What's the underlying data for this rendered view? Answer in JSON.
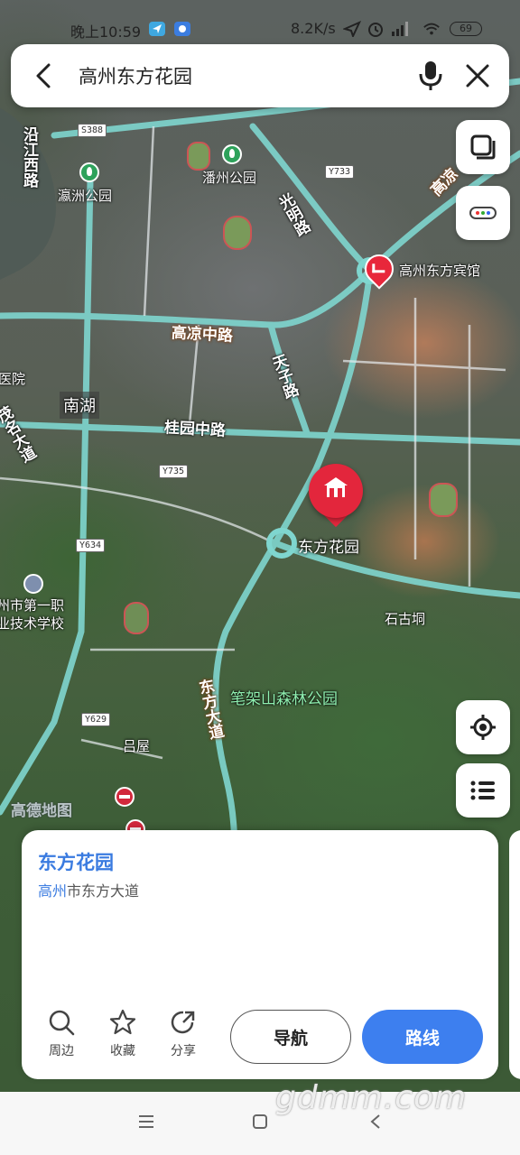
{
  "status_bar": {
    "time": "晚上10:59",
    "network_speed": "8.2K/s",
    "battery": "69"
  },
  "search": {
    "query": "高州东方花园"
  },
  "map": {
    "road_labels": {
      "s388": "S388",
      "y733": "Y733",
      "y735": "Y735",
      "y634": "Y634",
      "y629": "Y629",
      "gaoliang_mid": "高凉中路",
      "guiyuan_mid": "桂园中路",
      "guangming": "光明路",
      "tianzi": "天子路",
      "yanjiang_west": "沿江西路",
      "maoming_ave": "茂名大道",
      "dongfang_ave": "东方大道",
      "gaoliang_edge": "高凉"
    },
    "places": {
      "yingzhou_park": "瀛洲公园",
      "panzhou_park": "潘州公园",
      "hotel": "高州东方宾馆",
      "nanhu": "南湖",
      "hospital_partial": "医院",
      "school_line1": "州市第一职",
      "school_line2": "业技术学校",
      "shigu": "石古垌",
      "bijiashan": "笔架山森林公园",
      "lvwu": "吕屋",
      "marker": "东方花园"
    },
    "watermark": "高德地图"
  },
  "card": {
    "name": "东方花园",
    "address_city": "高州",
    "address_rest": "市东方大道",
    "actions": [
      {
        "label": "周边",
        "icon": "search-icon"
      },
      {
        "label": "收藏",
        "icon": "star-icon"
      },
      {
        "label": "分享",
        "icon": "share-icon"
      }
    ],
    "nav_label": "导航",
    "route_label": "路线"
  },
  "site_watermark": "gdmm.com",
  "colors": {
    "accent_blue": "#3d7fef",
    "marker_red": "#e3263c",
    "park_green": "#2ea25b",
    "road_cyan": "#7fd6cf"
  }
}
